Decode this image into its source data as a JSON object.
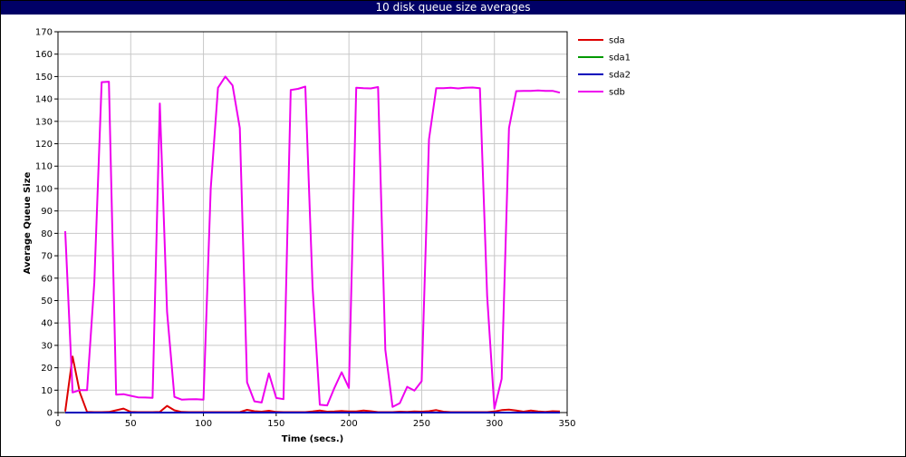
{
  "window": {
    "title": "10 disk queue size averages"
  },
  "chart_data": {
    "type": "line",
    "title": "10 disk queue size averages",
    "xlabel": "Time (secs.)",
    "ylabel": "Average Queue Size",
    "xlim": [
      0,
      350
    ],
    "ylim": [
      0,
      170
    ],
    "xticks": [
      "0",
      "50",
      "100",
      "150",
      "200",
      "250",
      "300",
      "350"
    ],
    "yticks": [
      "0",
      "10",
      "20",
      "30",
      "40",
      "50",
      "60",
      "70",
      "80",
      "90",
      "100",
      "110",
      "120",
      "130",
      "140",
      "150",
      "160",
      "170"
    ],
    "grid": true,
    "legend_position": "right",
    "series": [
      {
        "name": "sda",
        "color": "#dd0000",
        "x": [
          5,
          10,
          15,
          20,
          25,
          30,
          35,
          40,
          45,
          50,
          55,
          60,
          65,
          70,
          75,
          80,
          85,
          90,
          95,
          100,
          105,
          110,
          115,
          120,
          125,
          130,
          135,
          140,
          145,
          150,
          155,
          160,
          165,
          170,
          175,
          180,
          185,
          190,
          195,
          200,
          205,
          210,
          215,
          220,
          225,
          230,
          235,
          240,
          245,
          250,
          255,
          260,
          265,
          270,
          275,
          280,
          285,
          290,
          295,
          300,
          305,
          310,
          315,
          320,
          325,
          330,
          335,
          340,
          345
        ],
        "y": [
          0.5,
          25,
          9,
          0.3,
          0.2,
          0.2,
          0.3,
          1,
          1.8,
          0.3,
          0.2,
          0.2,
          0.2,
          0.3,
          3,
          1,
          0.3,
          0.2,
          0.2,
          0.2,
          0.2,
          0.2,
          0.2,
          0.2,
          0.2,
          1.2,
          0.6,
          0.4,
          0.8,
          0.3,
          0.2,
          0.2,
          0.2,
          0.2,
          0.5,
          0.9,
          0.4,
          0.5,
          0.7,
          0.5,
          0.5,
          0.9,
          0.6,
          0.2,
          0.2,
          0.2,
          0.4,
          0.3,
          0.5,
          0.4,
          0.6,
          1.1,
          0.4,
          0.2,
          0.2,
          0.2,
          0.2,
          0.2,
          0.2,
          0.5,
          1.1,
          1.3,
          0.9,
          0.4,
          0.9,
          0.5,
          0.3,
          0.6,
          0.5
        ]
      },
      {
        "name": "sda1",
        "color": "#009900",
        "x": [
          5,
          10,
          15,
          20,
          345
        ],
        "y": [
          0,
          0,
          0,
          0,
          0
        ]
      },
      {
        "name": "sda2",
        "color": "#0000bb",
        "x": [
          5,
          345
        ],
        "y": [
          0,
          0
        ]
      },
      {
        "name": "sdb",
        "color": "#ee00ee",
        "x": [
          5,
          10,
          15,
          20,
          25,
          30,
          35,
          40,
          45,
          50,
          55,
          60,
          65,
          70,
          75,
          80,
          85,
          90,
          95,
          100,
          105,
          110,
          115,
          120,
          125,
          130,
          135,
          140,
          145,
          150,
          155,
          160,
          165,
          170,
          175,
          180,
          185,
          190,
          195,
          200,
          205,
          210,
          215,
          220,
          225,
          230,
          235,
          240,
          245,
          250,
          255,
          260,
          265,
          270,
          275,
          280,
          285,
          290,
          295,
          300,
          305,
          310,
          315,
          320,
          325,
          330,
          335,
          340,
          345
        ],
        "y": [
          81,
          9,
          10,
          10,
          58,
          147.5,
          147.7,
          8,
          8.2,
          7.5,
          6.8,
          6.7,
          6.6,
          138,
          45,
          7,
          5.8,
          5.9,
          6,
          5.8,
          100,
          145,
          150,
          146,
          127,
          13.5,
          5,
          4.5,
          17.5,
          6.5,
          6,
          144,
          144.5,
          145.5,
          56,
          3.5,
          3.2,
          11,
          18,
          11,
          145,
          144.8,
          144.7,
          145.3,
          28,
          2.5,
          4.2,
          11.5,
          9.8,
          14,
          122,
          144.8,
          144.8,
          145,
          144.7,
          145,
          145.1,
          144.8,
          52,
          1.8,
          15,
          127,
          143.5,
          143.6,
          143.6,
          143.8,
          143.6,
          143.6,
          142.8
        ]
      }
    ]
  }
}
